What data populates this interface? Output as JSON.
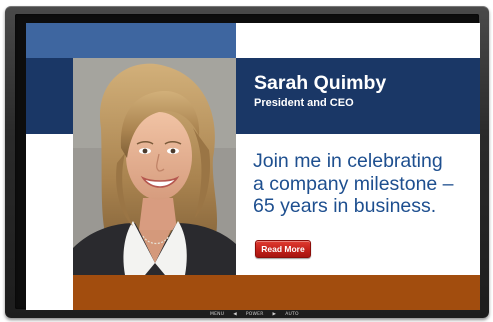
{
  "profile": {
    "name": "Sarah Quimby",
    "title": "President and CEO"
  },
  "headline": {
    "lines": [
      "Join me in celebrating",
      "a company milestone –",
      "65 years in business."
    ]
  },
  "cta": {
    "label": "Read More"
  },
  "monitor_controls": {
    "menu": "MENU",
    "prev": "◀",
    "power": "POWER",
    "next": "▶",
    "auto": "AUTO"
  },
  "colors": {
    "navy": "#1a3766",
    "blue_band": "#3e66a0",
    "brown_band": "#a24d0e",
    "headline_blue": "#1e4f8f",
    "button_red": "#c3211a"
  }
}
